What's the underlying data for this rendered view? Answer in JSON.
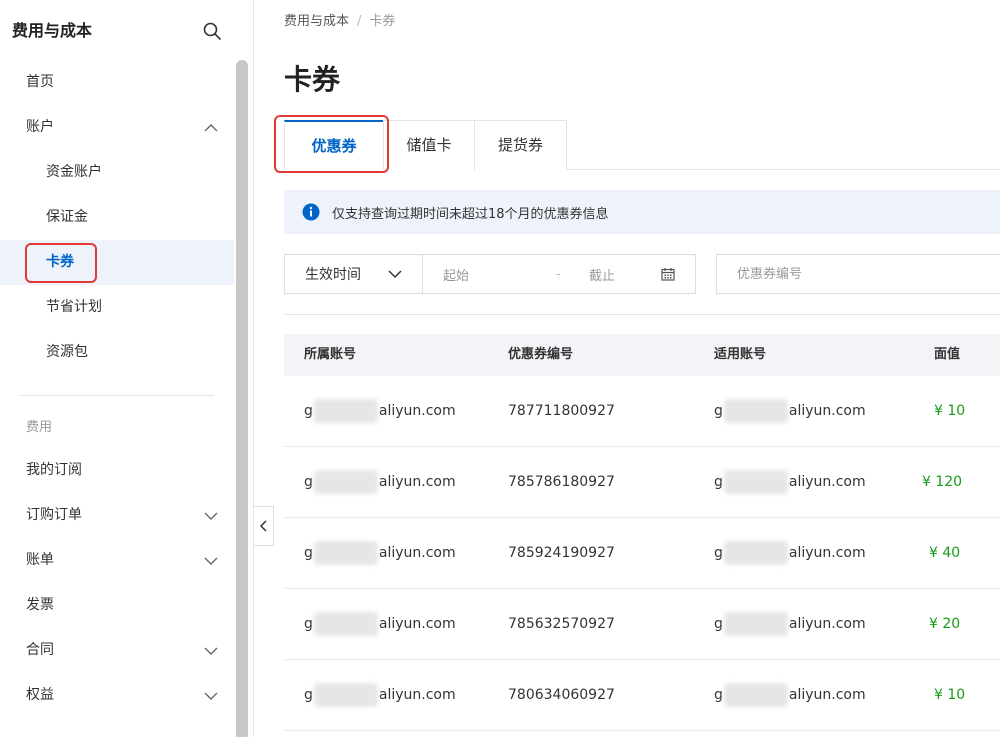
{
  "sidebar": {
    "title": "费用与成本",
    "items": [
      {
        "label": "首页",
        "name": "sidebar-item-home"
      },
      {
        "label": "账户",
        "name": "sidebar-item-account"
      },
      {
        "label": "资金账户",
        "name": "sidebar-item-fund-account"
      },
      {
        "label": "保证金",
        "name": "sidebar-item-deposit"
      },
      {
        "label": "卡券",
        "name": "sidebar-item-cards"
      },
      {
        "label": "节省计划",
        "name": "sidebar-item-savings-plan"
      },
      {
        "label": "资源包",
        "name": "sidebar-item-resource-pack"
      }
    ],
    "group_label": "费用",
    "items2": [
      {
        "label": "我的订阅"
      },
      {
        "label": "订购订单"
      },
      {
        "label": "账单"
      },
      {
        "label": "发票"
      },
      {
        "label": "合同"
      },
      {
        "label": "权益"
      }
    ]
  },
  "breadcrumb": {
    "parent": "费用与成本",
    "separator": "/",
    "current": "卡券"
  },
  "page_title": "卡券",
  "tabs": [
    {
      "label": "优惠券",
      "active": true
    },
    {
      "label": "储值卡",
      "active": false
    },
    {
      "label": "提货券",
      "active": false
    }
  ],
  "notice": "仅支持查询过期时间未超过18个月的优惠券信息",
  "filter": {
    "select_value": "生效时间",
    "date_start": "起始",
    "date_dash": "-",
    "date_end": "截止",
    "search_placeholder": "优惠券编号"
  },
  "table": {
    "headers": [
      "所属账号",
      "优惠券编号",
      "适用账号",
      "面值"
    ],
    "rows": [
      {
        "acc_prefix": "g",
        "acc_suffix": "aliyun.com",
        "coupon": "787711800927",
        "app_prefix": "g",
        "app_suffix": "aliyun.com",
        "value": "¥ 10"
      },
      {
        "acc_prefix": "g",
        "acc_suffix": "aliyun.com",
        "coupon": "785786180927",
        "app_prefix": "g",
        "app_suffix": "aliyun.com",
        "value": "¥ 120"
      },
      {
        "acc_prefix": "g",
        "acc_suffix": "aliyun.com",
        "coupon": "785924190927",
        "app_prefix": "g",
        "app_suffix": "aliyun.com",
        "value": "¥ 40"
      },
      {
        "acc_prefix": "g",
        "acc_suffix": "aliyun.com",
        "coupon": "785632570927",
        "app_prefix": "g",
        "app_suffix": "aliyun.com",
        "value": "¥ 20"
      },
      {
        "acc_prefix": "g",
        "acc_suffix": "aliyun.com",
        "coupon": "780634060927",
        "app_prefix": "g",
        "app_suffix": "aliyun.com",
        "value": "¥ 10"
      }
    ]
  },
  "colors": {
    "accent": "#0064c8",
    "value_green": "#1a9a1a",
    "highlight_red": "#e53935"
  }
}
